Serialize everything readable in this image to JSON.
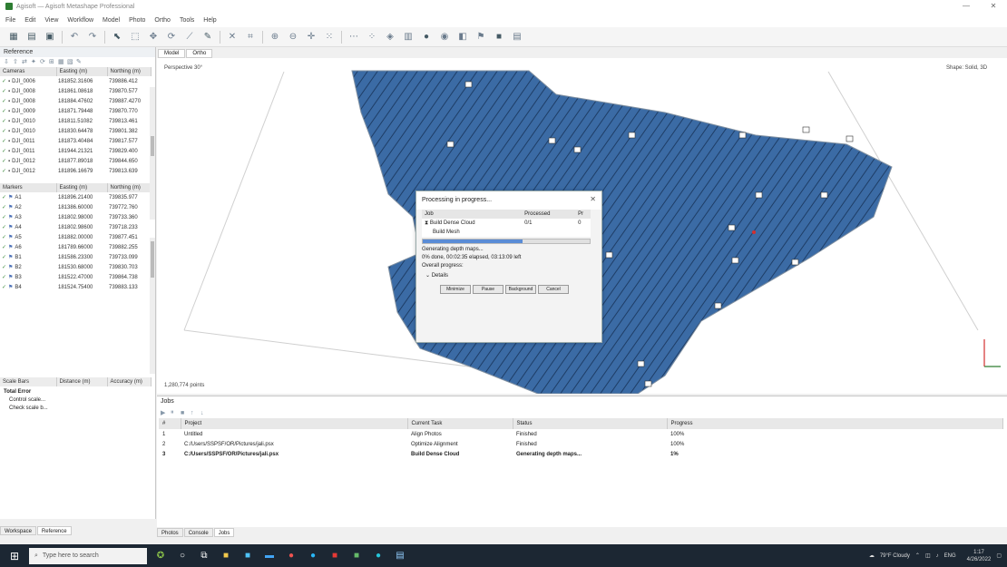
{
  "window": {
    "title": "Agisoft — Agisoft Metashape Professional",
    "controls": [
      "—",
      "□",
      "✕"
    ]
  },
  "menu": [
    "File",
    "Edit",
    "View",
    "Workflow",
    "Model",
    "Photo",
    "Ortho",
    "Tools",
    "Help"
  ],
  "reference": {
    "title": "Reference",
    "cameras": {
      "headers": [
        "Cameras",
        "Easting (m)",
        "Northing (m)"
      ],
      "rows": [
        {
          "label": "DJI_0006",
          "easting": "181852.31606",
          "northing": "739886.412"
        },
        {
          "label": "DJI_0008",
          "easting": "181861.08618",
          "northing": "739870.577"
        },
        {
          "label": "DJI_0008",
          "easting": "181884.47602",
          "northing": "739887.4270"
        },
        {
          "label": "DJI_0009",
          "easting": "181871.79448",
          "northing": "739870.770"
        },
        {
          "label": "DJI_0010",
          "easting": "181811.51082",
          "northing": "739813.461"
        },
        {
          "label": "DJI_0010",
          "easting": "181830.64478",
          "northing": "739801.382"
        },
        {
          "label": "DJI_0011",
          "easting": "181873.40484",
          "northing": "739817.577"
        },
        {
          "label": "DJI_0011",
          "easting": "181944.21321",
          "northing": "739829.400"
        },
        {
          "label": "DJI_0012",
          "easting": "181877.89018",
          "northing": "739844.650"
        },
        {
          "label": "DJI_0012",
          "easting": "181896.16679",
          "northing": "739813.639"
        }
      ]
    },
    "markers": {
      "headers": [
        "Markers",
        "Easting (m)",
        "Northing (m)"
      ],
      "rows": [
        {
          "label": "A1",
          "easting": "181896.21400",
          "northing": "739835.977"
        },
        {
          "label": "A2",
          "easting": "181386.60000",
          "northing": "739772.760"
        },
        {
          "label": "A3",
          "easting": "181802.98000",
          "northing": "739733.360"
        },
        {
          "label": "A4",
          "easting": "181802.98600",
          "northing": "739718.233"
        },
        {
          "label": "A5",
          "easting": "181882.00000",
          "northing": "739877.451"
        },
        {
          "label": "A6",
          "easting": "181789.66000",
          "northing": "739882.255"
        },
        {
          "label": "B1",
          "easting": "181586.23300",
          "northing": "739733.099"
        },
        {
          "label": "B2",
          "easting": "181530.68000",
          "northing": "739830.703"
        },
        {
          "label": "B3",
          "easting": "181522.47000",
          "northing": "739864.738"
        },
        {
          "label": "B4",
          "easting": "181524.75400",
          "northing": "739883.133"
        }
      ]
    },
    "scale_headers": [
      "Scale Bars",
      "Distance (m)",
      "Accuracy (m)"
    ],
    "total_error": "Total Error",
    "total_error_items": [
      "Control scale...",
      "Check scale b..."
    ],
    "tabs": [
      "Workspace",
      "Reference"
    ]
  },
  "viewport": {
    "tabs": [
      "Model",
      "Ortho"
    ],
    "perspective": "Perspective 30°",
    "view_label": "Shape: Solid, 3D",
    "status": "1,280,774 points",
    "colors": {
      "mesh": "#3b6ba5",
      "edge": "#1e3d66"
    }
  },
  "dialog": {
    "title": "Processing in progress...",
    "headers": [
      "Job",
      "Processed",
      "Pr"
    ],
    "rows": [
      {
        "job": "Build Dense Cloud",
        "processed": "0/1",
        "pr": "0"
      },
      {
        "job": "Build Mesh",
        "processed": "",
        "pr": ""
      }
    ],
    "progress": 0.6,
    "status_lines": [
      "Generating depth maps...",
      "0% done, 00:02:35 elapsed, 03:13:09 left",
      "Overall progress:"
    ],
    "details": "Details",
    "buttons": [
      "Minimize",
      "Pause",
      "Background",
      "Cancel"
    ]
  },
  "jobs": {
    "title": "Jobs",
    "headers": [
      "#",
      "Project",
      "Current Task",
      "Status",
      "Progress"
    ],
    "rows": [
      {
        "n": "1",
        "project": "Untitled",
        "task": "Align Photos",
        "status": "Finished",
        "progress": "100%"
      },
      {
        "n": "2",
        "project": "C:/Users/SSPSF/OR/Pictures/jali.psx",
        "task": "Optimize Alignment",
        "status": "Finished",
        "progress": "100%"
      },
      {
        "n": "3",
        "project": "C:/Users/SSPSF/OR/Pictures/jali.psx",
        "task": "Build Dense Cloud",
        "status": "Generating depth maps...",
        "progress": "1%"
      }
    ],
    "tabs": [
      "Photos",
      "Console",
      "Jobs"
    ]
  },
  "taskbar": {
    "search_placeholder": "Type here to search",
    "weather": "79°F Cloudy",
    "lang": "ENG",
    "time": "1:17",
    "date": "4/26/2022"
  }
}
